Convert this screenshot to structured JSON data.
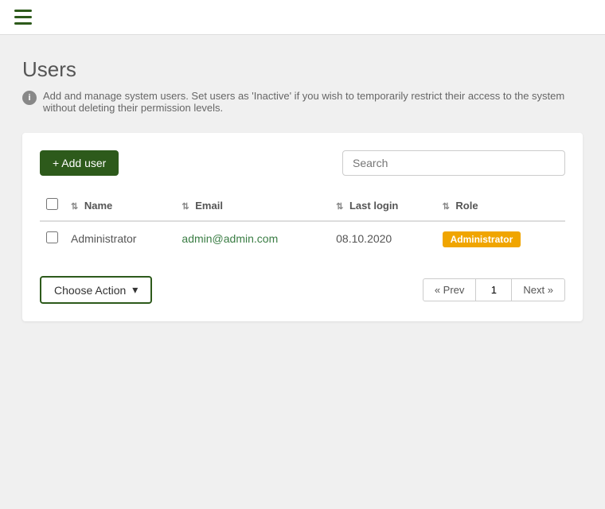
{
  "topbar": {
    "hamburger_label": "Menu"
  },
  "page": {
    "title": "Users",
    "info_text": "Add and manage system users. Set users as 'Inactive' if you wish to temporarily restrict their access to the system without deleting their permission levels."
  },
  "card": {
    "add_user_label": "+ Add user",
    "search_placeholder": "Search",
    "table": {
      "columns": [
        {
          "key": "name",
          "label": "Name"
        },
        {
          "key": "email",
          "label": "Email"
        },
        {
          "key": "last_login",
          "label": "Last login"
        },
        {
          "key": "role",
          "label": "Role"
        }
      ],
      "rows": [
        {
          "name": "Administrator",
          "email": "admin@admin.com",
          "last_login": "08.10.2020",
          "role": "Administrator"
        }
      ]
    },
    "choose_action_label": "Choose Action",
    "pagination": {
      "prev_label": "« Prev",
      "next_label": "Next »",
      "current_page": "1"
    }
  },
  "colors": {
    "green_dark": "#2d5a1b",
    "badge_orange": "#f0a500"
  }
}
